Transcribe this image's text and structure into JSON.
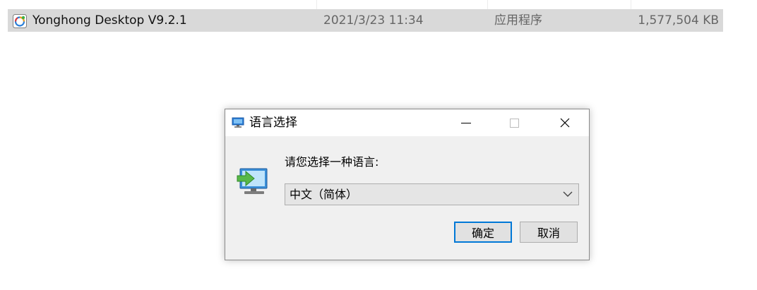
{
  "file_row": {
    "name": "Yonghong Desktop V9.2.1",
    "date": "2021/3/23 11:34",
    "type": "应用程序",
    "size": "1,577,504 KB",
    "icon": "yonghong-app-icon"
  },
  "dialog": {
    "title": "语言选择",
    "prompt": "请您选择一种语言:",
    "selected_language": "中文（简体）",
    "ok_label": "确定",
    "cancel_label": "取消",
    "accent_color": "#0078d7"
  }
}
